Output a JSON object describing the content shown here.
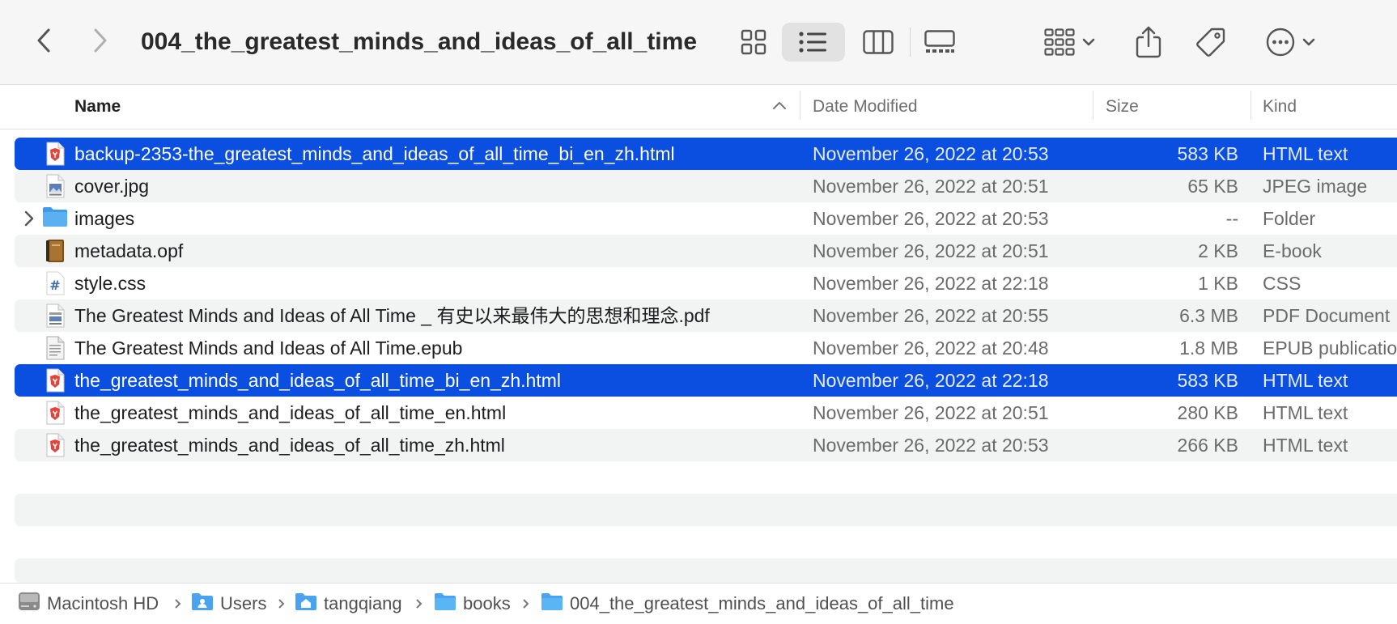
{
  "window": {
    "title": "004_the_greatest_minds_and_ideas_of_all_time"
  },
  "toolbar": {
    "back_icon": "chevron-left-icon",
    "forward_icon": "chevron-right-icon",
    "view_modes": [
      "icon-view",
      "list-view",
      "column-view",
      "gallery-view"
    ],
    "active_view": "list-view",
    "group_icon": "group-by-icon",
    "share_icon": "share-icon",
    "tag_icon": "tag-icon",
    "more_icon": "ellipsis-circle-icon"
  },
  "columns": {
    "name": "Name",
    "date": "Date Modified",
    "size": "Size",
    "kind": "Kind"
  },
  "files": [
    {
      "name": "backup-2353-the_greatest_minds_and_ideas_of_all_time_bi_en_zh.html",
      "date": "November 26, 2022 at 20:53",
      "size": "583 KB",
      "kind": "HTML text",
      "icon": "html-file-icon",
      "selected": true
    },
    {
      "name": "cover.jpg",
      "date": "November 26, 2022 at 20:51",
      "size": "65 KB",
      "kind": "JPEG image",
      "icon": "image-file-icon",
      "selected": false
    },
    {
      "name": "images",
      "date": "November 26, 2022 at 20:53",
      "size": "--",
      "kind": "Folder",
      "icon": "folder-icon",
      "selected": false
    },
    {
      "name": "metadata.opf",
      "date": "November 26, 2022 at 20:51",
      "size": "2 KB",
      "kind": "E-book",
      "icon": "ebook-icon",
      "selected": false
    },
    {
      "name": "style.css",
      "date": "November 26, 2022 at 22:18",
      "size": "1 KB",
      "kind": "CSS",
      "icon": "css-file-icon",
      "selected": false
    },
    {
      "name": "The Greatest Minds and Ideas of All Time _ 有史以来最伟大的思想和理念.pdf",
      "date": "November 26, 2022 at 20:55",
      "size": "6.3 MB",
      "kind": "PDF Document",
      "icon": "pdf-file-icon",
      "selected": false
    },
    {
      "name": "The Greatest Minds and Ideas of All Time.epub",
      "date": "November 26, 2022 at 20:48",
      "size": "1.8 MB",
      "kind": "EPUB publication",
      "icon": "epub-file-icon",
      "selected": false
    },
    {
      "name": "the_greatest_minds_and_ideas_of_all_time_bi_en_zh.html",
      "date": "November 26, 2022 at 22:18",
      "size": "583 KB",
      "kind": "HTML text",
      "icon": "html-file-icon",
      "selected": true
    },
    {
      "name": "the_greatest_minds_and_ideas_of_all_time_en.html",
      "date": "November 26, 2022 at 20:51",
      "size": "280 KB",
      "kind": "HTML text",
      "icon": "html-file-icon",
      "selected": false
    },
    {
      "name": "the_greatest_minds_and_ideas_of_all_time_zh.html",
      "date": "November 26, 2022 at 20:53",
      "size": "266 KB",
      "kind": "HTML text",
      "icon": "html-file-icon",
      "selected": false
    }
  ],
  "pathbar": [
    {
      "label": "Macintosh HD",
      "icon": "hard-drive-icon"
    },
    {
      "label": "Users",
      "icon": "users-folder-icon"
    },
    {
      "label": "tangqiang",
      "icon": "home-folder-icon"
    },
    {
      "label": "books",
      "icon": "folder-icon"
    },
    {
      "label": "004_the_greatest_minds_and_ideas_of_all_time",
      "icon": "folder-icon"
    }
  ],
  "colors": {
    "selection": "#0b4fe0",
    "stripe": "#f2f3f3",
    "folder": "#5ab0f0",
    "brave_red": "#e8433a"
  }
}
